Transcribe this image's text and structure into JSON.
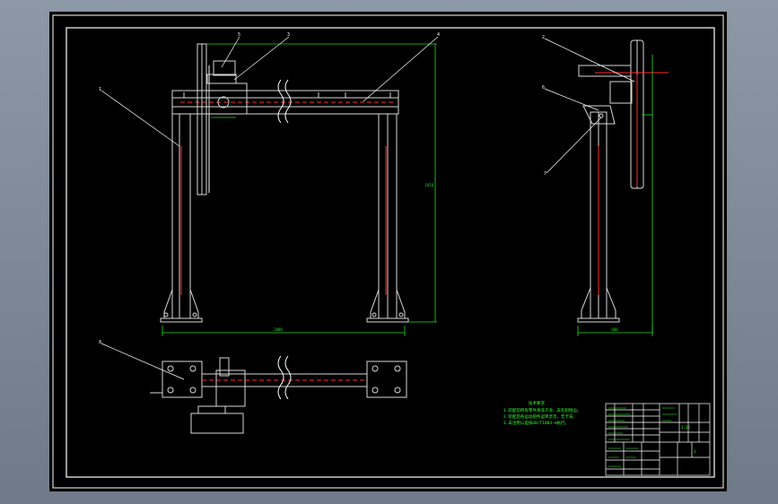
{
  "drawing": {
    "background": "#000000",
    "frame_color": "#ffffff",
    "line_color": "#d8d8d8",
    "centerline_color": "#ff2a2a",
    "dimension_color": "#22dd22",
    "leader_color": "#ffffff",
    "notes_color": "#33ff33"
  },
  "views": [
    {
      "name": "front-view",
      "label": ""
    },
    {
      "name": "side-view",
      "label": ""
    },
    {
      "name": "top-view",
      "label": ""
    }
  ],
  "balloons": [
    "5",
    "3",
    "4",
    "1",
    "2",
    "6",
    "7",
    "8"
  ],
  "dimensions": {
    "front_width": "2000",
    "front_height": "1850",
    "side_width": "600"
  },
  "notes": {
    "title": "技术要求",
    "lines": [
      "1.装配前所有零件清洗干净，去毛刺锐边。",
      "2.装配后各运动部件运转灵活，无卡滞。",
      "3.未注明公差按GB/T1804-m执行。"
    ]
  },
  "title_block": {
    "drawing_title": "",
    "scale": "1:10",
    "sheet": "1"
  }
}
